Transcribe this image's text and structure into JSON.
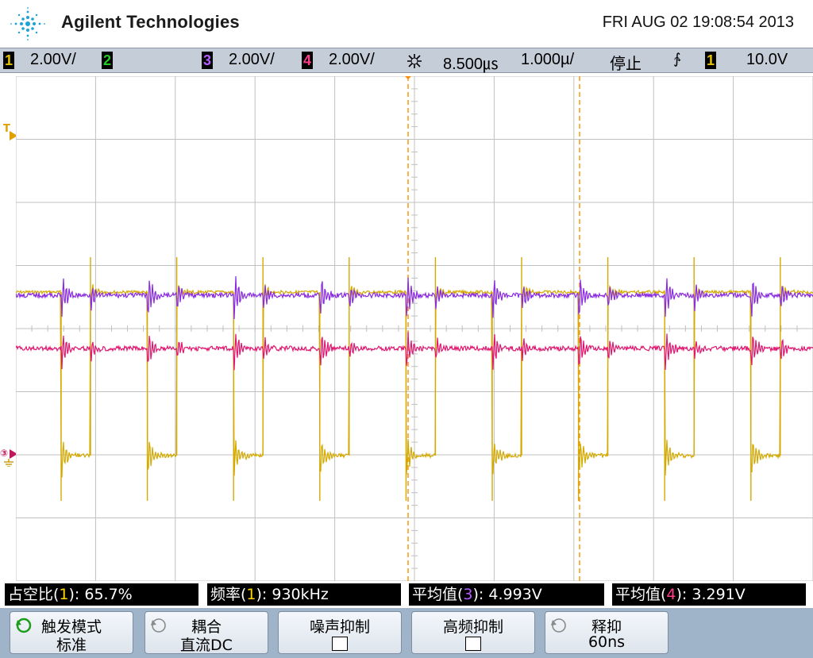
{
  "header": {
    "brand": "Agilent Technologies",
    "datetime": "FRI AUG 02 19:08:54 2013"
  },
  "status_bar": {
    "ch1_num": "1",
    "ch1_scale": "2.00V/",
    "ch2_num": "2",
    "ch3_num": "3",
    "ch3_scale": "2.00V/",
    "ch4_num": "4",
    "ch4_scale": "2.00V/",
    "delay": "8.500㎲",
    "timebase": "1.000µ/",
    "run_state": "停止",
    "trigger_slope": "∱",
    "trigger_source_num": "1",
    "trigger_level": "10.0V"
  },
  "markers": {
    "trigger_level_marker": "T",
    "ground_marker": "③"
  },
  "measurements": [
    {
      "label_pre": "占空比(",
      "src": "1",
      "label_post": "): 65.7%"
    },
    {
      "label_pre": "频率(",
      "src": "1",
      "label_post": "): 930kHz"
    },
    {
      "label_pre": "平均值(",
      "src": "3",
      "label_post": "): 4.993V"
    },
    {
      "label_pre": "平均值(",
      "src": "4",
      "label_post": "): 3.291V"
    }
  ],
  "softkeys": [
    {
      "line1": "触发模式",
      "line2": "标准"
    },
    {
      "line1": "耦合",
      "line2": "直流DC"
    },
    {
      "line1": "噪声抑制",
      "line2": ""
    },
    {
      "line1": "高频抑制",
      "line2": ""
    },
    {
      "line1": "释抑",
      "line2": "60ns"
    }
  ],
  "colors": {
    "ch1": "#d4aa00",
    "ch2": "#22cc22",
    "ch3": "#8a2be2",
    "ch4": "#e0156f",
    "cursor": "#ff8c00",
    "grid": "#c0c0c0",
    "status_bg": "#c5cdd8",
    "softkey_bg": "#9fb3c9"
  }
}
